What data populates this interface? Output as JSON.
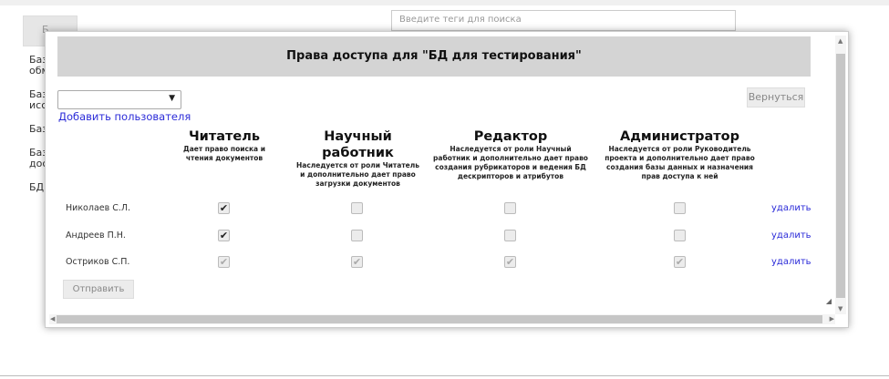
{
  "background": {
    "button_label": "Б...",
    "search_placeholder": "Введите теги для поиска",
    "left_items": [
      "Баз",
      "обм",
      "Баз",
      "исс",
      "Баз",
      "Баз",
      "дос",
      "БД"
    ]
  },
  "dialog": {
    "title": "Права доступа для \"БД для тестирования\"",
    "user_select_value": "",
    "add_user_label": "Добавить пользователя",
    "back_label": "Вернуться",
    "roles": [
      {
        "name": "Читатель",
        "desc": "Дает право поиска и чтения документов"
      },
      {
        "name": "Научный работник",
        "desc": "Наследуется от роли Читатель и дополнительно дает право загрузки документов"
      },
      {
        "name": "Редактор",
        "desc": "Наследуется от роли Научный работник и дополнительно дает право создания рубрикаторов и ведения БД дескрипторов и атрибутов"
      },
      {
        "name": "Администратор",
        "desc": "Наследуется от роли Руководитель проекта и дополнительно дает право создания базы данных и назначения прав доступа к ней"
      }
    ],
    "users": [
      {
        "name": "Николаев С.Л.",
        "perms": [
          true,
          false,
          false,
          false
        ],
        "disabled": false,
        "delete_label": "удалить"
      },
      {
        "name": "Андреев П.Н.",
        "perms": [
          true,
          false,
          false,
          false
        ],
        "disabled": false,
        "delete_label": "удалить"
      },
      {
        "name": "Остриков С.П.",
        "perms": [
          true,
          true,
          true,
          true
        ],
        "disabled": true,
        "delete_label": "удалить"
      }
    ],
    "submit_label": "Отправить"
  }
}
